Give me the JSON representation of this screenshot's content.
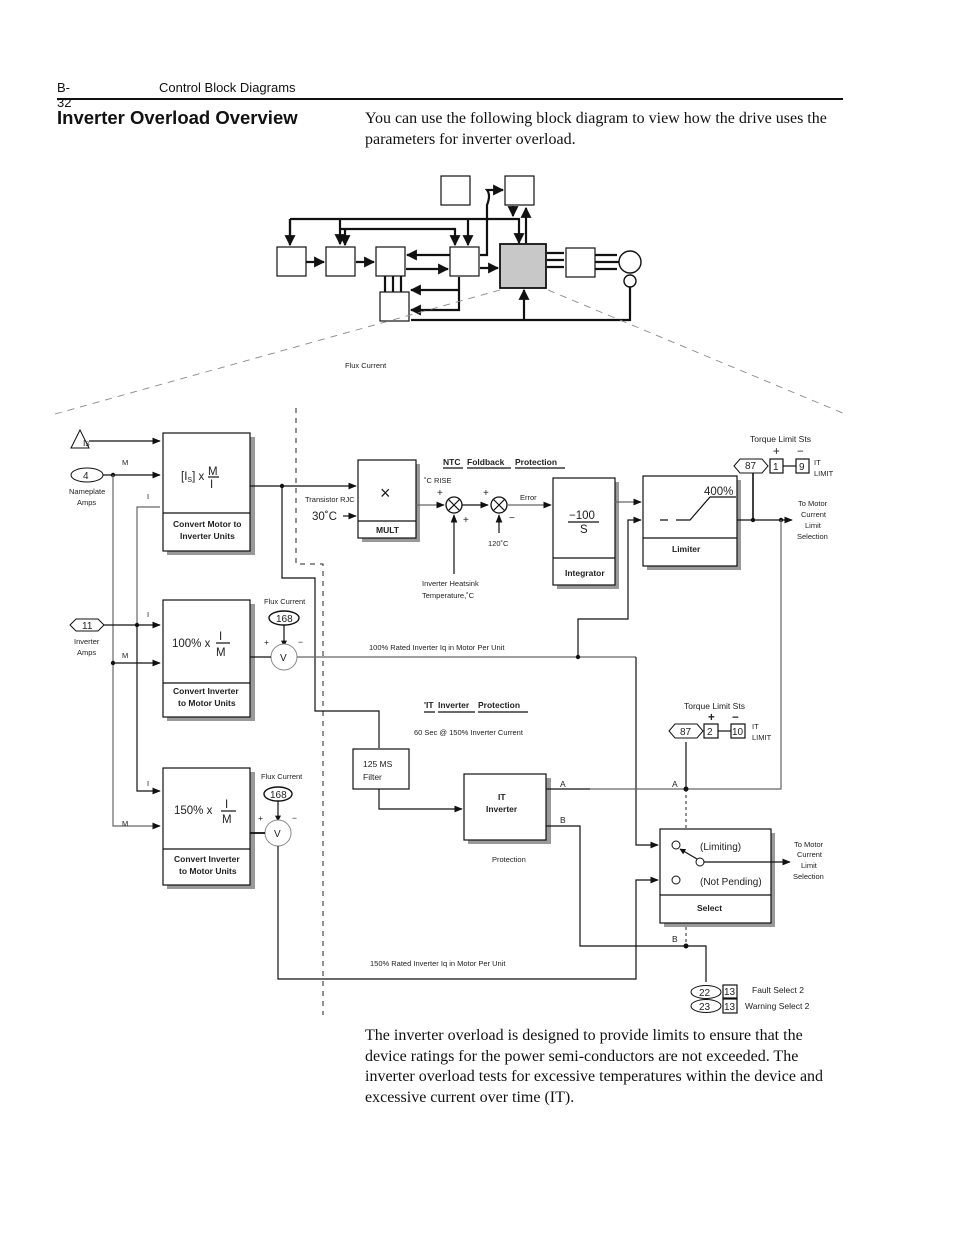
{
  "header": {
    "page_number": "B-32",
    "section": "Control Block Diagrams"
  },
  "title": "Inverter Overload Overview",
  "intro": "You can use the following block diagram to view how the drive uses the parameters for inverter overload.",
  "outro": "The inverter overload is designed to provide limits to ensure that the device ratings for the power semi-conductors are not exceeded. The inverter overload tests for excessive temperatures within the device and excessive current over time (IT).",
  "diagram": {
    "overview_label": "Flux Current",
    "inputs": {
      "is_label": "Is",
      "nameplate_param": "4",
      "nameplate_label_1": "Nameplate",
      "nameplate_label_2": "Amps",
      "inverter_param": "11",
      "inverter_label_1": "Inverter",
      "inverter_label_2": "Amps",
      "m_label": "M",
      "i_label": "I"
    },
    "convert_motor": {
      "formula_prefix": "[I",
      "formula_sub": "S",
      "formula_suffix": "] x",
      "num": "M",
      "den": "I",
      "title_1": "Convert Motor to",
      "title_2": "Inverter Units"
    },
    "convert_inv_100": {
      "formula_prefix": "100% x",
      "num": "I",
      "den": "M",
      "title_1": "Convert Inverter",
      "title_2": "to Motor Units"
    },
    "convert_inv_150": {
      "formula_prefix": "150% x",
      "num": "I",
      "den": "M",
      "title_1": "Convert Inverter",
      "title_2": "to Motor Units"
    },
    "flux_current_label": "Flux Current",
    "flux_param": "168",
    "v_label": "V",
    "plus": "+",
    "minus": "−",
    "mult": {
      "symbol": "×",
      "title": "MULT",
      "rjc_label": "Transistor RJC",
      "rjc_value": "30˚C"
    },
    "ntc": {
      "title_words": [
        "NTC",
        "Foldback",
        "Protection"
      ],
      "c_rise": "˚C RISE",
      "error": "Error",
      "setpoint": "120˚C",
      "heatsink_1": "Inverter Heatsink",
      "heatsink_2": "Temperature,˚C"
    },
    "integrator": {
      "num": "−100",
      "den": "S",
      "title": "Integrator"
    },
    "limiter": {
      "limit": "400%",
      "title": "Limiter"
    },
    "torque_limit_1": {
      "label": "Torque Limit Sts",
      "param": "87",
      "bit_plus": "1",
      "bit_minus": "9",
      "it_1": "IT",
      "it_2": "LIMIT"
    },
    "torque_limit_2": {
      "label": "Torque Limit Sts",
      "param": "87",
      "bit_plus": "2",
      "bit_minus": "10",
      "it_1": "IT",
      "it_2": "LIMIT"
    },
    "to_motor_1": [
      "To Motor",
      "Current",
      "Limit",
      "Selection"
    ],
    "to_motor_2": [
      "To Motor",
      "Current",
      "Limit",
      "Selection"
    ],
    "rated_100": "100% Rated Inverter Iq in Motor Per Unit",
    "rated_150": "150%  Rated Inverter Iq in Motor Per Unit",
    "it_protection": {
      "title_words": [
        "'IT",
        "Inverter",
        "Protection"
      ],
      "subtitle": "60 Sec @ 150% Inverter Current"
    },
    "filter": {
      "line_1": "125 MS",
      "line_2": "Filter"
    },
    "it_block": {
      "line_1": "IT",
      "line_2": "Inverter",
      "caption": "Protection",
      "out_a": "A",
      "out_b": "B"
    },
    "select": {
      "limiting": "(Limiting)",
      "not_pending": "(Not  Pending)",
      "title": "Select",
      "a": "A",
      "b": "B"
    },
    "faults": [
      {
        "param": "22",
        "bit": "13",
        "label": "Fault Select 2"
      },
      {
        "param": "23",
        "bit": "13",
        "label": "Warning Select 2"
      }
    ]
  }
}
